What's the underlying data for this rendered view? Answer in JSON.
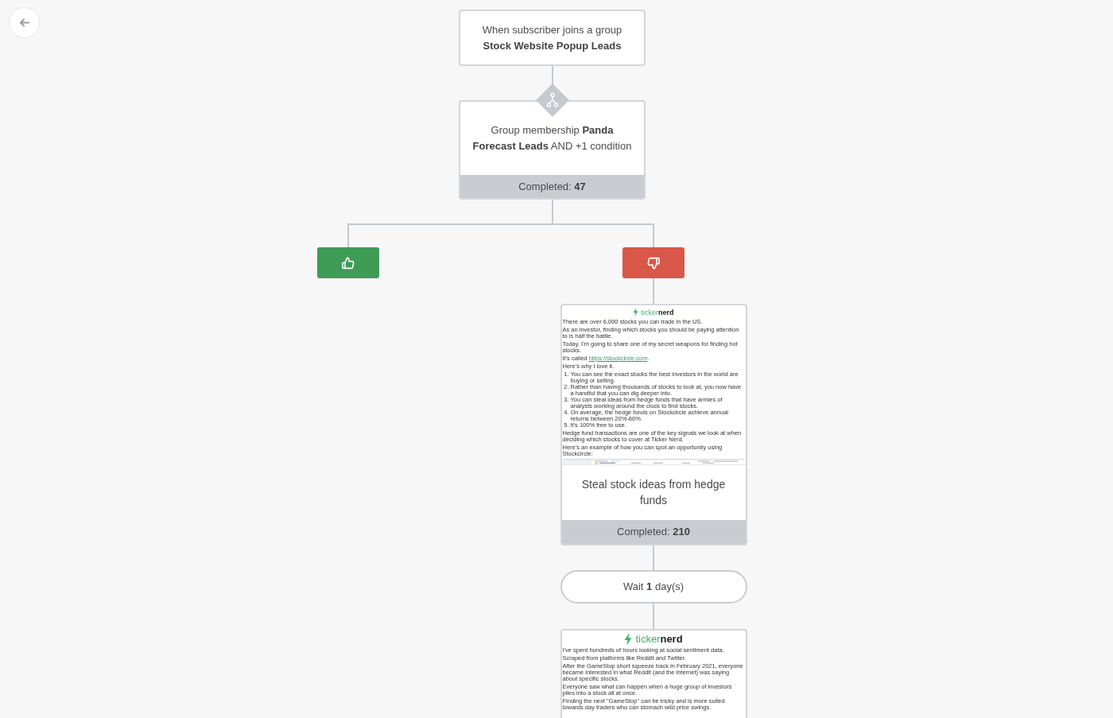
{
  "workflow": {
    "trigger": {
      "label": "When subscriber joins a group",
      "group": "Stock Website Popup Leads"
    },
    "condition": {
      "text": "Group membership **Panda Forecast Leads** AND +1 condition",
      "completed": "Completed: **47**"
    },
    "branches": [
      {
        "kind": "yes"
      },
      {
        "kind": "no",
        "steps": [
          {
            "kind": "email",
            "preview": {
              "logo": "ticker**nerd**",
              "blocks": [
                {
                  "kind": "paragraph",
                  "text": "There are over 6,000 stocks you can trade in the US."
                },
                {
                  "kind": "paragraph",
                  "text": "As an investor, finding which stocks you should be paying attention to is half the battle."
                },
                {
                  "kind": "paragraph",
                  "text": "Today, I'm going to share one of my secret weapons for finding hot stocks."
                },
                {
                  "kind": "link_paragraph",
                  "text": "It's called",
                  "link": "https://stockcircle.com",
                  "after": "."
                },
                {
                  "kind": "paragraph",
                  "text": "Here's why I love it."
                },
                {
                  "kind": "list",
                  "items": [
                    {
                      "marker": "1.",
                      "text": "You can see the exact stocks the best investors in the world are buying or selling."
                    },
                    {
                      "marker": "2.",
                      "text": "Rather than having thousands of stocks to look at, you now have a handful that you can dig deeper into."
                    },
                    {
                      "marker": "3.",
                      "text": "You can steal ideas from hedge funds that have armies of analysts working around the clock to find stocks."
                    },
                    {
                      "marker": "4.",
                      "text": "On average, the hedge funds on Stockcircle achieve annual returns between 20%-60%."
                    },
                    {
                      "marker": "5.",
                      "text": "It's 100% free to use."
                    }
                  ]
                },
                {
                  "kind": "paragraph",
                  "text": "Hedge fund transactions are one of the key signals we look at when deciding which stocks to cover at Ticker Nerd."
                },
                {
                  "kind": "paragraph",
                  "text": "Here's an example of how you can spot an opportunity using Stockcircle:"
                },
                {
                  "kind": "image"
                }
              ]
            },
            "title": "Steal stock ideas from hedge funds",
            "completed": "Completed: **210**"
          },
          {
            "kind": "delay",
            "text": "Wait **1** day(s)"
          },
          {
            "kind": "email",
            "preview": {
              "logo": "ticker**nerd**",
              "blocks": [
                {
                  "kind": "paragraph",
                  "text": "I've spent hundreds of hours looking at social sentiment data."
                },
                {
                  "kind": "paragraph",
                  "text": "Scraped from platforms like Reddit and Twitter."
                },
                {
                  "kind": "paragraph",
                  "text": "After the GameStop short squeeze back in February 2021, everyone became interested in what Reddit (and the internet) was saying about specific stocks."
                },
                {
                  "kind": "paragraph",
                  "text": "Everyone saw what can happen when a huge group of investors piles into a stock all at once."
                },
                {
                  "kind": "paragraph",
                  "text": "Finding the next \"GameStop\" can be tricky and is more suited towards day traders who can stomach wild price swings."
                }
              ]
            }
          }
        ]
      }
    ]
  }
}
